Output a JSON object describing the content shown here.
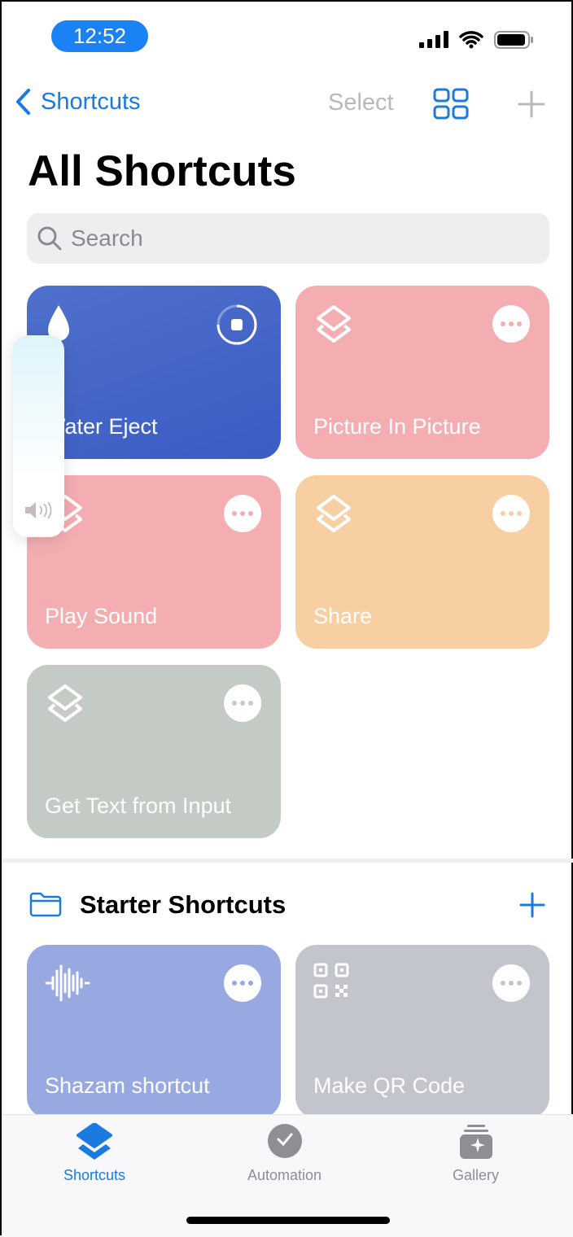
{
  "status": {
    "time": "12:52"
  },
  "nav": {
    "back_label": "Shortcuts",
    "select_label": "Select"
  },
  "page": {
    "title": "All Shortcuts"
  },
  "search": {
    "placeholder": "Search"
  },
  "shortcuts": [
    {
      "name": "Water Eject",
      "color": "#4460c8",
      "icon": "drop-icon",
      "state": "running"
    },
    {
      "name": "Picture In Picture",
      "color": "#f4aeb2",
      "icon": "layers-icon"
    },
    {
      "name": "Play Sound",
      "color": "#f4aeb2",
      "icon": "layers-icon"
    },
    {
      "name": "Share",
      "color": "#f8cfa2",
      "icon": "layers-icon"
    },
    {
      "name": "Get Text from Input",
      "color": "#c4cbc5",
      "icon": "layers-icon"
    }
  ],
  "starter": {
    "title": "Starter Shortcuts",
    "items": [
      {
        "name": "Shazam shortcut",
        "color": "#98a8e0",
        "icon": "waveform-icon"
      },
      {
        "name": "Make QR Code",
        "color": "#c2c6cc",
        "icon": "qr-code-icon"
      }
    ]
  },
  "tabs": [
    {
      "label": "Shortcuts",
      "active": true
    },
    {
      "label": "Automation",
      "active": false
    },
    {
      "label": "Gallery",
      "active": false
    }
  ],
  "colors": {
    "accent": "#1a7ae0"
  }
}
